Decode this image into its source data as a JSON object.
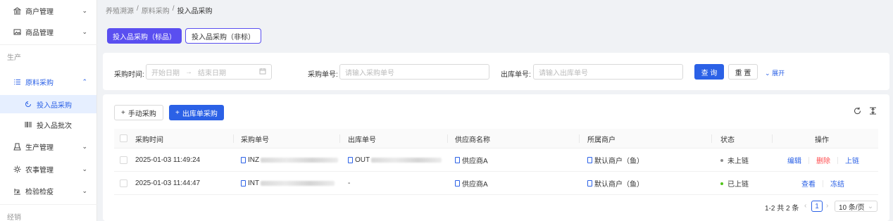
{
  "breadcrumb": [
    "养殖溯源",
    "原料采购",
    "投入品采购"
  ],
  "sidebar": {
    "items": [
      {
        "label": "商户管理",
        "icon": "bank-icon"
      },
      {
        "label": "商品管理",
        "icon": "image-icon"
      },
      {
        "label": "原料采购",
        "icon": "list-icon"
      },
      {
        "label": "生产管理",
        "icon": "flask-icon"
      },
      {
        "label": "农事管理",
        "icon": "gear-icon"
      },
      {
        "label": "检验检疫",
        "icon": "scale-icon"
      }
    ],
    "sections": {
      "production": "生产",
      "sales": "经销"
    },
    "subitems": [
      {
        "label": "投入品采购",
        "icon": "refresh-icon"
      },
      {
        "label": "投入品批次",
        "icon": "barcode-icon"
      }
    ]
  },
  "tabs": {
    "standard": "投入品采购（标品）",
    "nonstandard": "投入品采购（非标）"
  },
  "filters": {
    "time_label": "采购时间:",
    "start_placeholder": "开始日期",
    "arrow": "→",
    "end_placeholder": "结束日期",
    "purchase_no_label": "采购单号:",
    "purchase_no_placeholder": "请输入采购单号",
    "outbound_no_label": "出库单号:",
    "outbound_no_placeholder": "请输入出库单号",
    "query": "查 询",
    "reset": "重 置",
    "expand": "展开"
  },
  "toolbar": {
    "manual": "手动采购",
    "outbound": "出库单采购"
  },
  "table": {
    "headers": [
      "采购时间",
      "采购单号",
      "出库单号",
      "供应商名称",
      "所属商户",
      "状态",
      "操作"
    ],
    "rows": [
      {
        "time": "2025-01-03 11:49:24",
        "purchase_no": "INZ",
        "outbound_no": "OUT",
        "supplier": "供应商A",
        "merchant": "默认商户（鱼）",
        "status": "未上链",
        "status_color": "#8c8c8c",
        "actions": [
          "编辑",
          "删除",
          "上链"
        ]
      },
      {
        "time": "2025-01-03 11:44:47",
        "purchase_no": "INT",
        "outbound_no": "-",
        "supplier": "供应商A",
        "merchant": "默认商户（鱼）",
        "status": "已上链",
        "status_color": "#52c41a",
        "actions": [
          "查看",
          "冻结"
        ]
      }
    ]
  },
  "pagination": {
    "total": "1-2 共 2 条",
    "current": "1",
    "page_size": "10 条/页"
  },
  "colors": {
    "primary": "#2b61e6",
    "tab_primary": "#5a4ff0",
    "danger": "#ff4d4f"
  }
}
